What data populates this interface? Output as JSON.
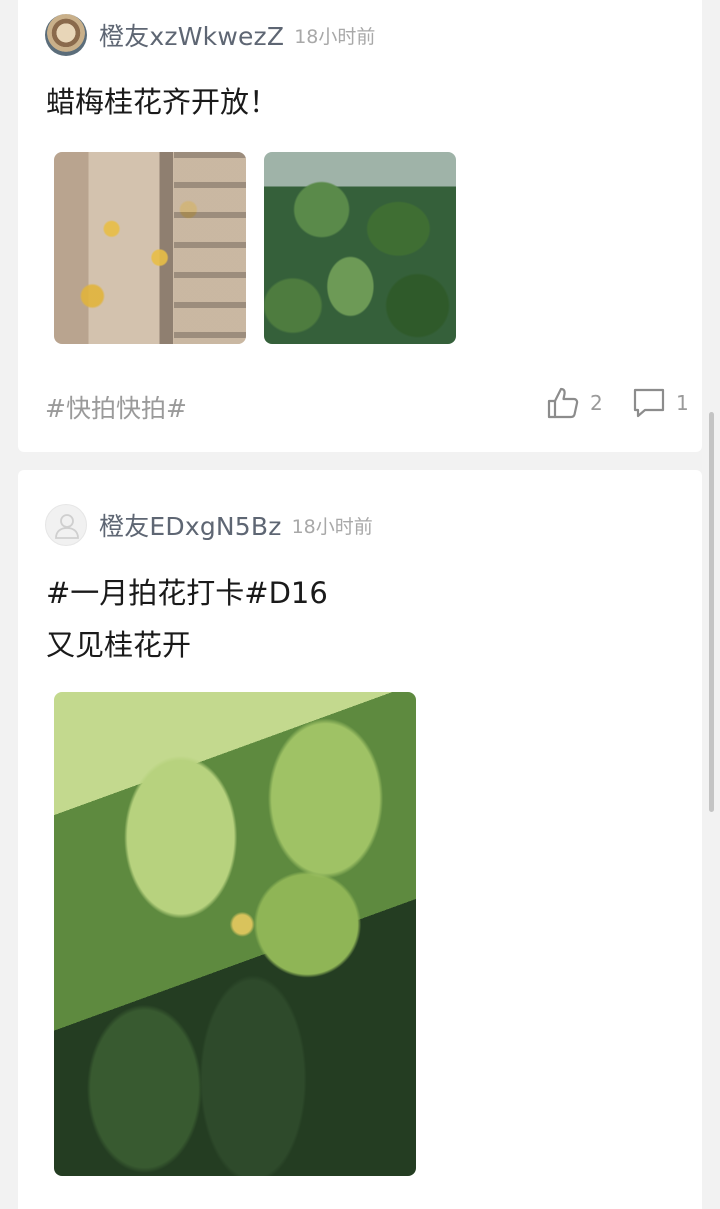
{
  "posts": [
    {
      "username": "橙友xzWkwezZ",
      "time": "18小时前",
      "text_lines": [
        "蜡梅桂花齐开放！"
      ],
      "tag": "#快拍快拍#",
      "likes": "2",
      "comments": "1"
    },
    {
      "username": "橙友EDxgN5Bz",
      "time": "18小时前",
      "text_lines": [
        "#一月拍花打卡#D16",
        "又见桂花开"
      ]
    }
  ],
  "icons": {
    "like": "thumbs-up-icon",
    "comment": "comment-bubble-icon"
  }
}
